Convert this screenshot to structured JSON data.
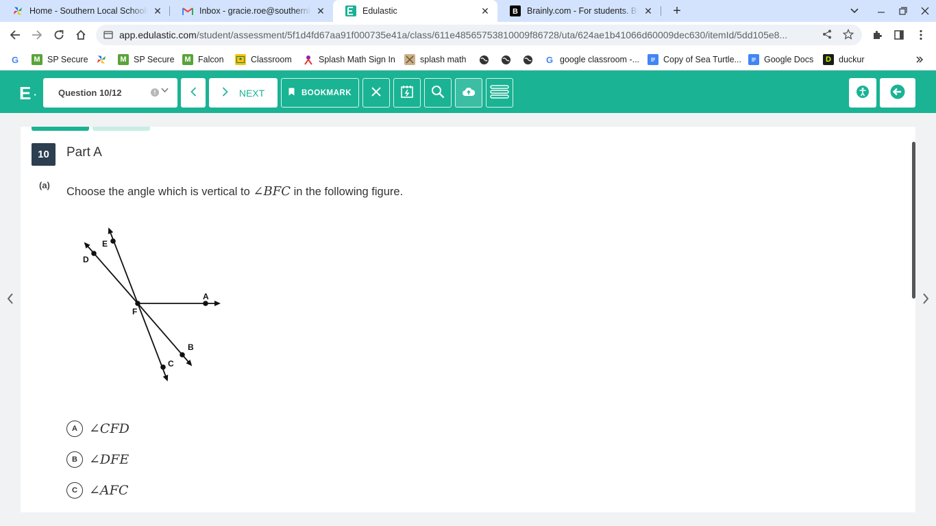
{
  "tabs": [
    {
      "title": "Home - Southern Local Schools",
      "icon": "pinwheel-icon"
    },
    {
      "title": "Inbox - gracie.roe@southernlocal.net",
      "icon": "gmail-icon"
    },
    {
      "title": "Edulastic",
      "icon": "edulastic-icon"
    },
    {
      "title": "Brainly.com - For students. By students.",
      "icon": "brainly-icon"
    }
  ],
  "address": {
    "host": "app.edulastic.com",
    "path": "/student/assessment/5f1d4fd67aa91f000735e41a/class/611e48565753810009f86728/uta/624ae1b41066d60009dec630/itemId/5dd105e8..."
  },
  "bookmarks": [
    {
      "label": "",
      "icon": "google-icon"
    },
    {
      "label": "SP Secure",
      "icon": "sp-icon"
    },
    {
      "label": "",
      "icon": "pinwheel-icon"
    },
    {
      "label": "SP Secure",
      "icon": "sp-icon"
    },
    {
      "label": "Falcon",
      "icon": "sp-icon"
    },
    {
      "label": "Classroom",
      "icon": "classroom-icon"
    },
    {
      "label": "Splash Math Sign In",
      "icon": "splash-icon"
    },
    {
      "label": "splash math",
      "icon": "splash-icon"
    },
    {
      "label": "",
      "icon": "globe-icon"
    },
    {
      "label": "",
      "icon": "globe-icon"
    },
    {
      "label": "google classroom -...",
      "icon": "google-icon"
    },
    {
      "label": "Copy of Sea Turtle...",
      "icon": "docs-icon"
    },
    {
      "label": "Google Docs",
      "icon": "docs-icon"
    },
    {
      "label": "duckur",
      "icon": "duckur-icon"
    }
  ],
  "header": {
    "logo": "E",
    "question_select": "Question 10/12",
    "next_label": "NEXT",
    "bookmark_label": "BOOKMARK"
  },
  "question": {
    "number": "10",
    "part_title": "Part A",
    "sub_label": "(a)",
    "text_before": "Choose the angle which is vertical to ",
    "text_math": "∠BFC",
    "text_after": " in the following figure."
  },
  "figure_labels": {
    "A": "A",
    "B": "B",
    "C": "C",
    "D": "D",
    "E": "E",
    "F": "F"
  },
  "options": [
    {
      "letter": "A",
      "text": "∠CFD"
    },
    {
      "letter": "B",
      "text": "∠DFE"
    },
    {
      "letter": "C",
      "text": "∠AFC"
    }
  ],
  "colors": {
    "brand": "#1ab394",
    "tabstrip": "#d3e3fd",
    "qnum_bg": "#2c3e50"
  }
}
